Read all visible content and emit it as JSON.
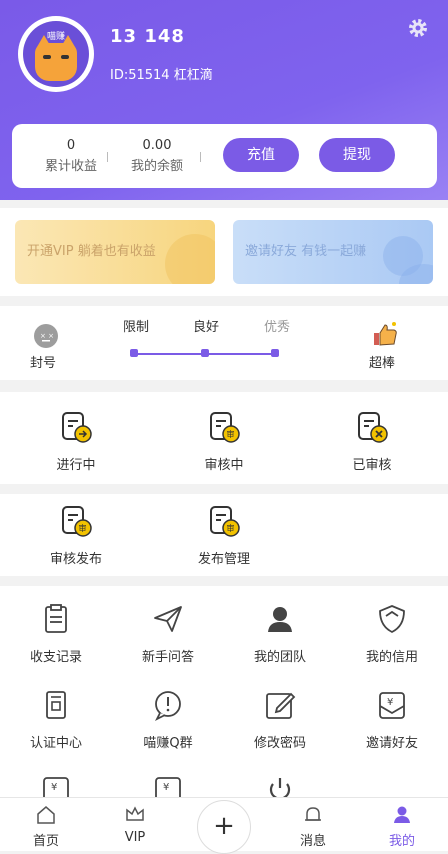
{
  "profile": {
    "phone": "13 148",
    "uid": "ID:51514 杠杠滴",
    "avatar_text": "喵赚"
  },
  "account": {
    "earnings_value": "0",
    "earnings_label": "累计收益",
    "balance_value": "0.00",
    "balance_label": "我的余额",
    "recharge_label": "充值",
    "withdraw_label": "提现"
  },
  "banners": {
    "vip": "开通VIP 躺着也有收益",
    "invite": "邀请好友 有钱一起赚"
  },
  "credit": {
    "left_label": "封号",
    "right_label": "超棒",
    "levels": [
      "限制",
      "良好",
      "优秀"
    ]
  },
  "orders": [
    "进行中",
    "审核中",
    "已审核"
  ],
  "publish": [
    "审核发布",
    "发布管理"
  ],
  "menu": [
    "收支记录",
    "新手问答",
    "我的团队",
    "我的信用",
    "认证中心",
    "喵赚Q群",
    "修改密码",
    "邀请好友"
  ],
  "tabs": [
    "首页",
    "VIP",
    "消息",
    "我的"
  ],
  "plus": "+",
  "colors": {
    "accent": "#7b5be6",
    "icon_yellow": "#f2c200"
  }
}
